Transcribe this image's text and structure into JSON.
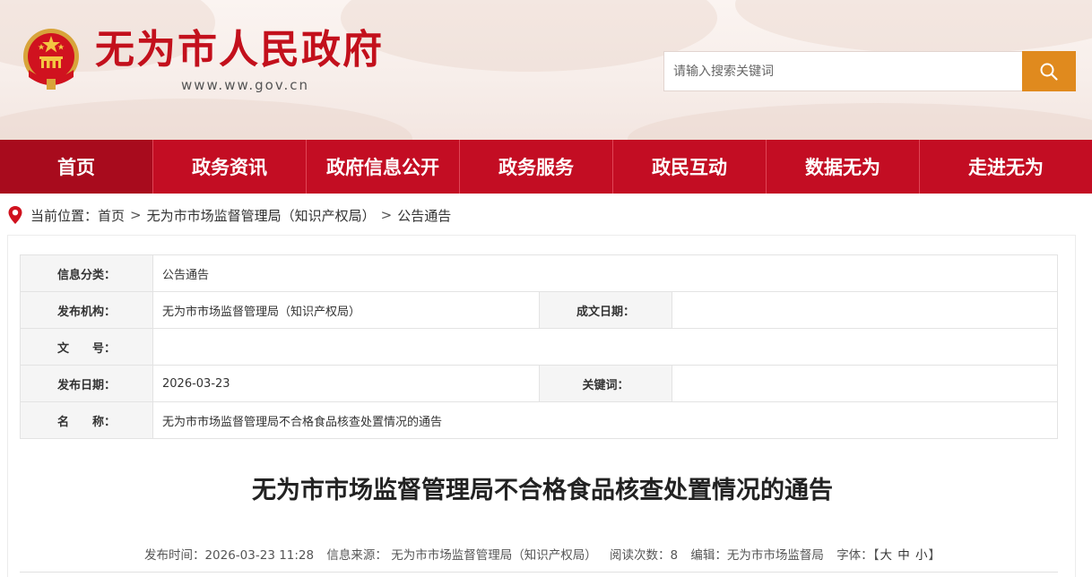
{
  "header": {
    "site_title": "无为市人民政府",
    "site_url": "www.ww.gov.cn",
    "search_placeholder": "请输入搜索关键词"
  },
  "nav": {
    "items": [
      "首页",
      "政务资讯",
      "政府信息公开",
      "政务服务",
      "政民互动",
      "数据无为",
      "走进无为"
    ],
    "active_index": 0
  },
  "breadcrumb": {
    "prefix": "当前位置：",
    "items": [
      "首页",
      "无为市市场监督管理局（知识产权局）",
      "公告通告"
    ],
    "separator": ">"
  },
  "meta_table": {
    "category_label": "信息分类：",
    "category_value": "公告通告",
    "publisher_label": "发布机构：",
    "publisher_value": "无为市市场监督管理局（知识产权局）",
    "created_label": "成文日期：",
    "created_value": "",
    "docno_label": "文　　号：",
    "docno_value": "",
    "pubdate_label": "发布日期：",
    "pubdate_value": "2026-03-23",
    "keywords_label": "关键词：",
    "keywords_value": "",
    "name_label": "名　　称：",
    "name_value": "无为市市场监督管理局不合格食品核查处置情况的通告"
  },
  "article": {
    "title": "无为市市场监督管理局不合格食品核查处置情况的通告",
    "publish_time": "发布时间：2026-03-23 11:28",
    "source": "信息来源：  无为市市场监督管理局（知识产权局）",
    "views_label": "阅读次数：",
    "views": "8",
    "editor": "编辑：无为市市场监督局",
    "font_label": "字体：",
    "font_open": "【",
    "font_large": "大",
    "font_medium": "中",
    "font_small": "小",
    "font_close": "】"
  },
  "colors": {
    "brand_red": "#c30d23",
    "title_red": "#c3101c",
    "search_orange": "#e08a1e"
  },
  "icons": {
    "emblem": "national-emblem-icon",
    "search": "search-icon",
    "location": "location-pin-icon"
  }
}
